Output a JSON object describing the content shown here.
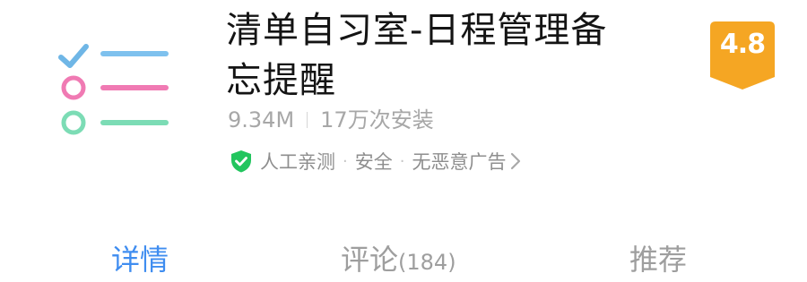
{
  "app": {
    "title": "清单自习室-日程管理备忘提醒",
    "size": "9.34M",
    "installs": "17万次安装",
    "rating": "4.8"
  },
  "safety": {
    "items": [
      "人工亲测",
      "安全",
      "无恶意广告"
    ],
    "separator": "·",
    "shield_color": "#22c55e"
  },
  "tabs": [
    {
      "label": "详情",
      "count": "",
      "active": true
    },
    {
      "label": "评论",
      "count": "(184)",
      "active": false
    },
    {
      "label": "推荐",
      "count": "",
      "active": false
    }
  ],
  "colors": {
    "active_tab": "#3f8df0",
    "rating_badge": "#f5a623"
  },
  "icons": {
    "app_icon": "checklist-icon",
    "shield": "shield-check-icon",
    "chevron": "chevron-right-icon"
  }
}
